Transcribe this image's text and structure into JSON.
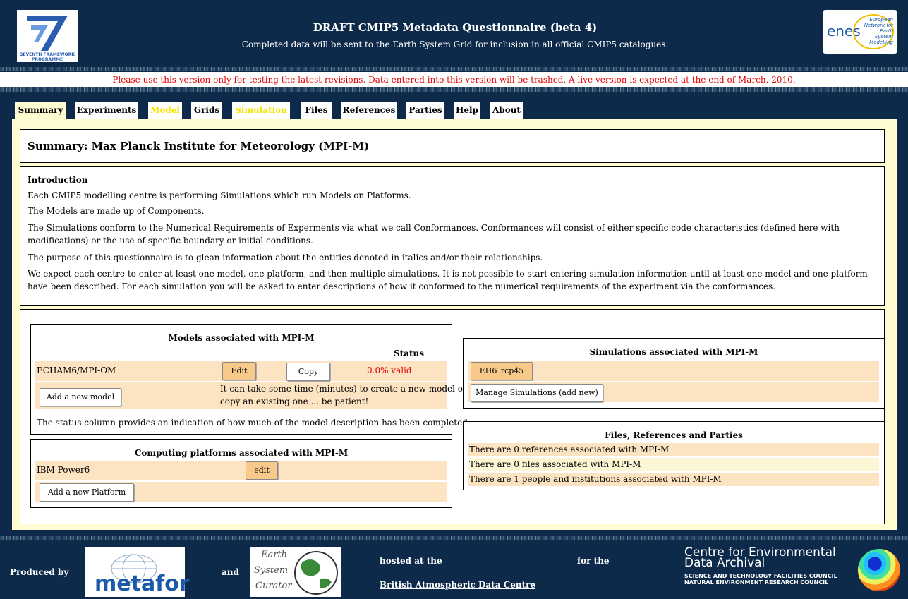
{
  "header": {
    "title": "DRAFT CMIP5 Metadata Questionnaire (beta 4)",
    "subtitle": "Completed data will be sent to the Earth System Grid for inclusion in all official CMIP5 catalogues.",
    "fp7_logo_text": "SEVENTH FRAMEWORK PROGRAMME",
    "enes_logo_text": "enes",
    "enes_logo_tagline": "European Network for Earth System Modelling"
  },
  "notice": "Please use this version only for testing the latest revisions. Data entered into this version will be trashed. A live version is expected at the end of March, 2010.",
  "tabs": [
    {
      "label": "Summary"
    },
    {
      "label": "Experiments"
    },
    {
      "label": "Model"
    },
    {
      "label": "Grids"
    },
    {
      "label": "Simulation"
    },
    {
      "label": "Files"
    },
    {
      "label": "References"
    },
    {
      "label": "Parties"
    },
    {
      "label": "Help"
    },
    {
      "label": "About"
    }
  ],
  "summary_title": "Summary: Max Planck Institute for Meteorology (MPI-M)",
  "intro": {
    "heading": "Introduction",
    "p1": "Each CMIP5 modelling centre is performing Simulations which run Models on Platforms.",
    "p2": "The Models are made up of Components.",
    "p3": "The Simulations conform to the Numerical Requirements of Experments via what we call Conformances. Conformances will consist of either specific code characteristics (defined here with modifications) or the use of specific boundary or initial conditions.",
    "p4": "The purpose of this questionnaire is to glean information about the entities denoted in italics and/or their relationships.",
    "p5": "We expect each centre to enter at least one model, one platform, and then multiple simulations. It is not possible to start entering simulation information until at least one model and one platform have been described. For each simulation you will be asked to enter descriptions of how it conformed to the numerical requirements of the experiment via the conformances."
  },
  "models": {
    "title": "Models associated with MPI-M",
    "status_header": "Status",
    "model_name": "ECHAM6/MPI-OM",
    "edit_label": "Edit",
    "copy_label": "Copy",
    "status_value": "0.0% valid",
    "add_label": "Add a new model",
    "wait_note_1": "It can take some time (minutes) to create a new model or",
    "wait_note_2": "copy an existing one ... be patient!",
    "status_note": "The status column provides an indication of how much of the model description has been completed."
  },
  "platforms": {
    "title": "Computing platforms associated with MPI-M",
    "platform_name": "IBM Power6",
    "edit_label": "edit",
    "add_label": "Add a new Platform"
  },
  "simulations": {
    "title": "Simulations associated with MPI-M",
    "simulation_name": "EH6_rcp45",
    "manage_label": "Manage Simulations (add new)"
  },
  "frp": {
    "title": "Files, References and Parties",
    "references": "There are 0 references associated with MPI-M",
    "files": "There are 0 files associated with MPI-M",
    "parties": "There are 1 people and institutions associated with MPI-M"
  },
  "footer": {
    "produced_by": "Produced by",
    "and": "and",
    "hosted_at": "hosted at the",
    "badc_link": "British Atmospheric Data Centre",
    "for_the": "for the",
    "metafor_logo": "metafor",
    "esc_logo_1": "Earth",
    "esc_logo_2": "System",
    "esc_logo_3": "Curator",
    "ceda_1": "Centre for Environmental",
    "ceda_2": "Data Archival",
    "ceda_3": "SCIENCE AND TECHNOLOGY FACILITIES COUNCIL",
    "ceda_4": "NATURAL ENVIRONMENT RESEARCH COUNCIL"
  },
  "colors": {
    "navy": "#0d2a4a",
    "cream": "#fffcd2",
    "peach_row": "#fce3c1",
    "orange_button": "#f7c98a",
    "notice_red": "#e40000",
    "tab_yellow": "#f5e400"
  }
}
